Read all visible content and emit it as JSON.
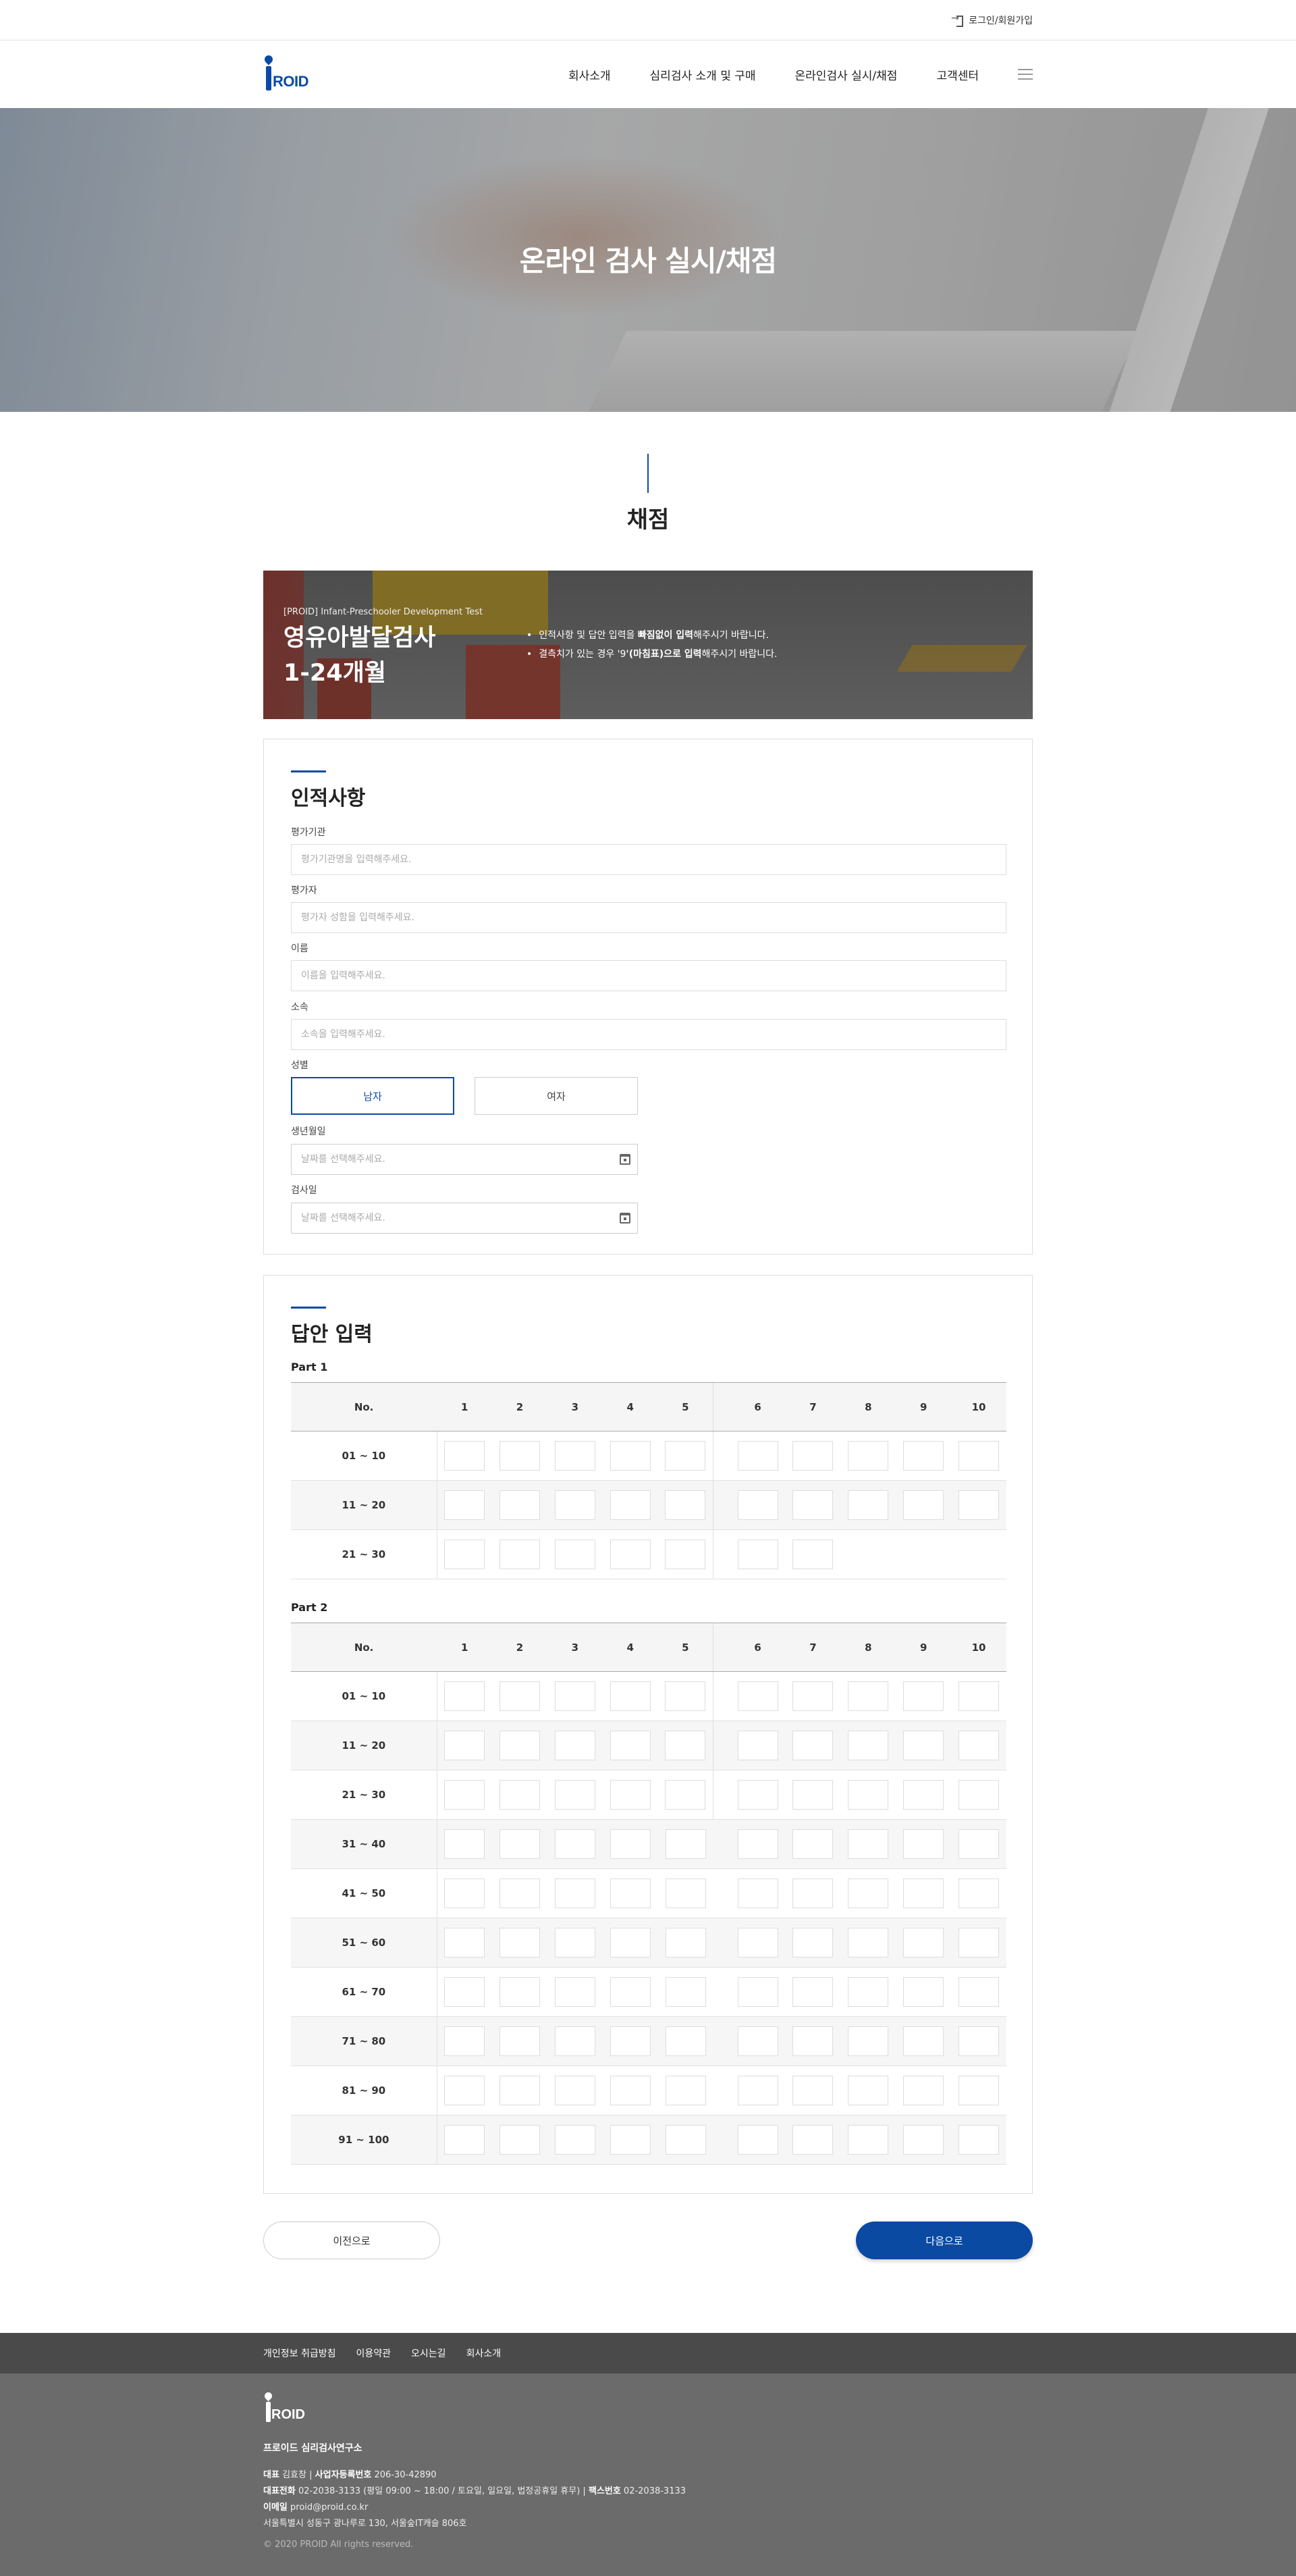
{
  "topbar": {
    "login_label": "로그인/회원가입"
  },
  "header": {
    "logo_text": "ROID",
    "nav": [
      "회사소개",
      "심리검사 소개 및 구매",
      "온라인검사 실시/채점",
      "고객센터"
    ]
  },
  "hero": {
    "title": "온라인 검사 실시/채점"
  },
  "section": {
    "title": "채점"
  },
  "banner": {
    "eyebrow": "[PROID] Infant-Preschooler Development Test",
    "title_line1": "영유아발달검사",
    "title_line2": "1-24개월",
    "notes": [
      {
        "pre": "인적사항 및 답안 입력을 ",
        "bold": "빠짐없이 입력",
        "post": "해주시기 바랍니다."
      },
      {
        "pre": "결측치가 있는 경우 '9",
        "bold": "'(마침표)으로 입력",
        "post": "해주시기 바랍니다."
      }
    ]
  },
  "personal": {
    "title": "인적사항",
    "fields": [
      {
        "label": "평가기관",
        "placeholder": "평가기관명을 입력해주세요."
      },
      {
        "label": "평가자",
        "placeholder": "평가자 성함을 입력해주세요."
      },
      {
        "label": "이름",
        "placeholder": "이름을 입력해주세요."
      },
      {
        "label": "소속",
        "placeholder": "소속을 입력해주세요."
      }
    ],
    "gender_label": "성별",
    "gender_male": "남자",
    "gender_female": "여자",
    "birth_label": "생년월일",
    "birth_placeholder": "날짜를 선택해주세요.",
    "test_date_label": "검사일",
    "test_date_placeholder": "날짜를 선택해주세요."
  },
  "answers": {
    "title": "답안 입력",
    "header_no": "No.",
    "columns": [
      "1",
      "2",
      "3",
      "4",
      "5",
      "6",
      "7",
      "8",
      "9",
      "10"
    ],
    "part1": {
      "label": "Part 1",
      "rows": [
        "01 ~ 10",
        "11 ~ 20",
        "21 ~ 30"
      ],
      "last_row_count": 7
    },
    "part2": {
      "label": "Part 2",
      "rows": [
        "01 ~ 10",
        "11 ~ 20",
        "21 ~ 30",
        "31 ~ 40",
        "41 ~ 50",
        "51 ~ 60",
        "61 ~ 70",
        "71 ~ 80",
        "81 ~ 90",
        "91 ~ 100"
      ]
    }
  },
  "buttons": {
    "prev": "이전으로",
    "next": "다음으로"
  },
  "footer": {
    "links": [
      "개인정보 취급방침",
      "이용약관",
      "오시는길",
      "회사소개"
    ],
    "company": "프로이드 심리검사연구소",
    "line1_k1": "대표",
    "line1_v1": "김효창",
    "line1_k2": "사업자등록번호",
    "line1_v2": "206-30-42890",
    "line2_k1": "대표전화",
    "line2_v1": "02-2038-3133 (평일 09:00 ~ 18:00 / 토요일, 일요일, 법정공휴일 휴무)",
    "line2_k2": "팩스번호",
    "line2_v2": "02-2038-3133",
    "line3_k1": "이메일",
    "line3_v1": "proid@proid.co.kr",
    "address": "서울특별시 성동구 광나루로 130, 서울숲IT캐슬 806호",
    "copyright": "© 2020 PROID All rights reserved."
  },
  "colors": {
    "brand_blue": "#0a4aa3",
    "footer_dark": "#4a4a4a",
    "footer_main": "#6b6b6b"
  }
}
